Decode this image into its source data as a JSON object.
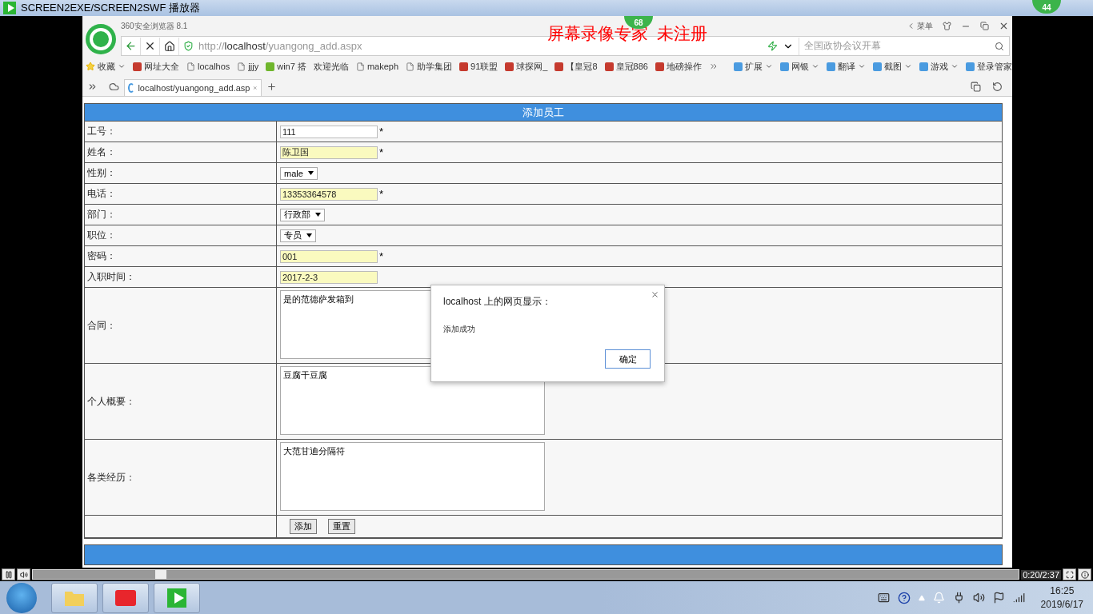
{
  "player": {
    "title": "SCREEN2EXE/SCREEN2SWF 播放器",
    "notice": "屏幕录像专家  未注册",
    "badges": [
      "68",
      "44"
    ],
    "progress": {
      "level": 0.13
    },
    "time": "0:20/2:37"
  },
  "browser": {
    "app_name": "360安全浏览器 8.1",
    "menu": "菜单",
    "url": {
      "scheme": "http://",
      "host": "localhost",
      "path": "/yuangong_add.aspx"
    },
    "search_placeholder": "全国政协会议开幕",
    "bookmarks": [
      {
        "label": "收藏",
        "kind": "star"
      },
      {
        "label": "网址大全",
        "kind": "site"
      },
      {
        "label": "localhos",
        "kind": "page"
      },
      {
        "label": "jjjy",
        "kind": "page"
      },
      {
        "label": "win7 搭",
        "kind": "seven"
      },
      {
        "label": "欢迎光临",
        "kind": "none"
      },
      {
        "label": "makeph",
        "kind": "page"
      },
      {
        "label": "助学集团",
        "kind": "page"
      },
      {
        "label": "91联盟",
        "kind": "site"
      },
      {
        "label": "球探网_",
        "kind": "site"
      },
      {
        "label": "【皇冠8",
        "kind": "site"
      },
      {
        "label": "皇冠886",
        "kind": "site"
      },
      {
        "label": "地磅操作",
        "kind": "site"
      }
    ],
    "tools": [
      {
        "label": "扩展",
        "dropdown": true
      },
      {
        "label": "网银",
        "dropdown": true
      },
      {
        "label": "翻译",
        "dropdown": true
      },
      {
        "label": "截图",
        "dropdown": true
      },
      {
        "label": "游戏",
        "dropdown": true
      },
      {
        "label": "登录管家",
        "dropdown": false
      }
    ],
    "tabs": [
      {
        "label": "localhost/yuangong_add.asp",
        "selected": true
      }
    ]
  },
  "form": {
    "title": "添加员工",
    "fields": [
      {
        "label": "工号：",
        "kind": "text",
        "value": "111",
        "autofilled": false,
        "mark": "*"
      },
      {
        "label": "姓名：",
        "kind": "text",
        "value": "陈卫国",
        "autofilled": true,
        "mark": "*"
      },
      {
        "label": "性别：",
        "kind": "select",
        "value": "male"
      },
      {
        "label": "电话：",
        "kind": "text",
        "value": "13353364578",
        "autofilled": true,
        "mark": "*"
      },
      {
        "label": "部门：",
        "kind": "select",
        "value": "行政部"
      },
      {
        "label": "职位：",
        "kind": "select",
        "value": "专员"
      },
      {
        "label": "密码：",
        "kind": "text",
        "value": "001",
        "autofilled": true,
        "mark": "*"
      },
      {
        "label": "入职时间：",
        "kind": "text",
        "value": "2017-2-3",
        "autofilled": true
      },
      {
        "label": "合同：",
        "kind": "textarea",
        "value": "是的范德萨发箱到"
      },
      {
        "label": "个人概要：",
        "kind": "textarea",
        "value": "豆腐干豆腐"
      },
      {
        "label": "各类经历：",
        "kind": "textarea",
        "value": "大范甘迪分隔符"
      }
    ],
    "buttons": [
      "添加",
      "重置"
    ]
  },
  "dialog": {
    "title": "localhost 上的网页显示：",
    "message": "添加成功",
    "ok": "确定"
  },
  "taskbar": {
    "time": "16:25",
    "date": "2019/6/17"
  }
}
